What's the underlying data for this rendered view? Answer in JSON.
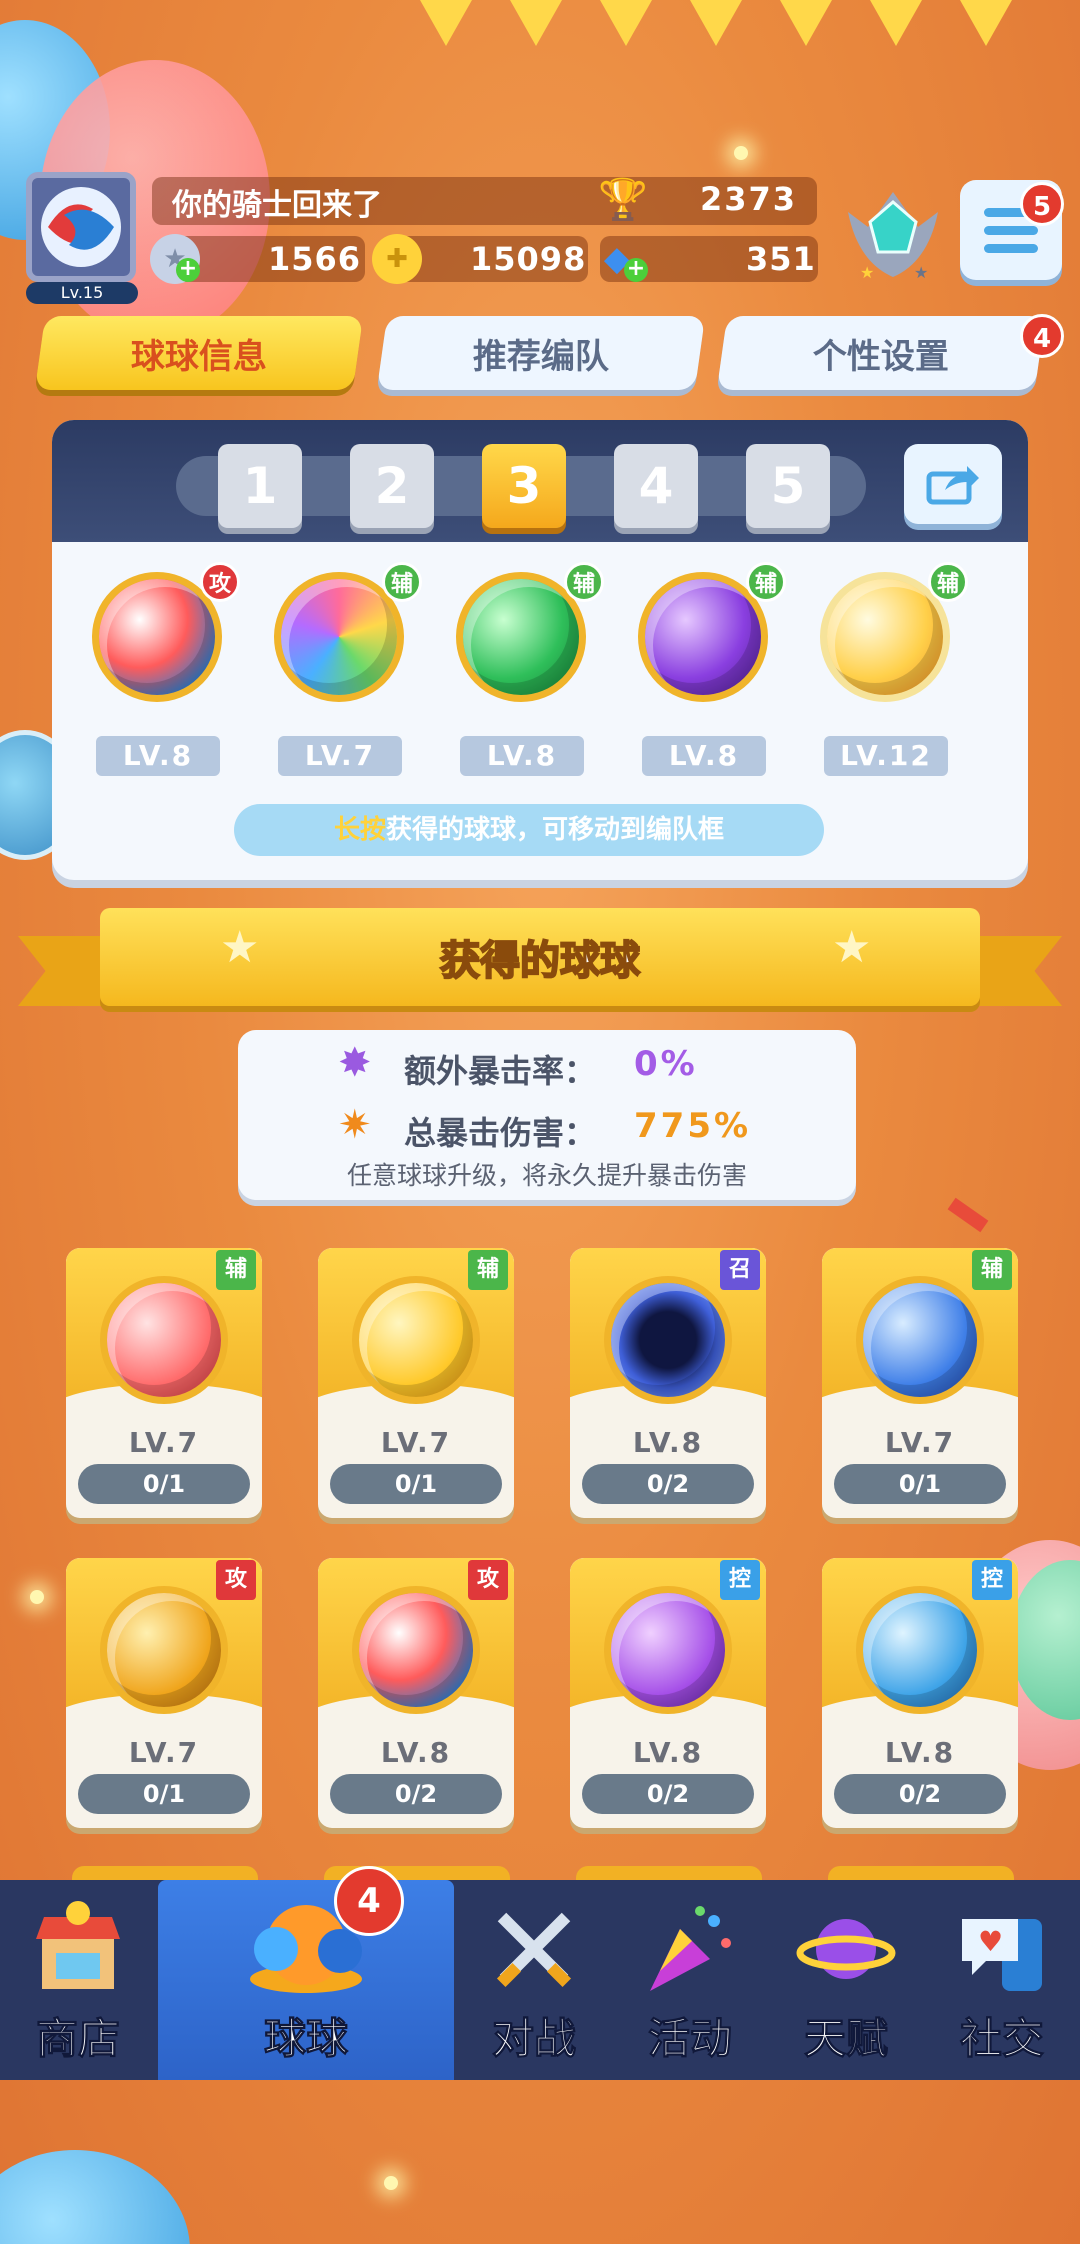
{
  "header": {
    "player_level": "Lv.15",
    "greeting": "你的骑士回来了",
    "trophies": "2373",
    "silver": "1566",
    "gold": "15098",
    "diamonds": "351",
    "menu_badge": "5"
  },
  "tabs": [
    {
      "label": "球球信息",
      "active": true
    },
    {
      "label": "推荐编队",
      "active": false
    },
    {
      "label": "个性设置",
      "active": false,
      "badge": "4"
    }
  ],
  "team": {
    "slots": [
      "1",
      "2",
      "3",
      "4",
      "5"
    ],
    "active_slot": "3",
    "balls": [
      {
        "role": "攻",
        "level": "LV.8"
      },
      {
        "role": "辅",
        "level": "LV.7"
      },
      {
        "role": "辅",
        "level": "LV.8"
      },
      {
        "role": "辅",
        "level": "LV.8"
      },
      {
        "role": "辅",
        "level": "LV.12"
      }
    ],
    "hint_highlight": "长按",
    "hint_rest": "获得的球球，可移动到编队框"
  },
  "collection": {
    "title": "获得的球球",
    "extra_crit_label": "额外暴击率：",
    "extra_crit_value": "0%",
    "total_crit_label": "总暴击伤害：",
    "total_crit_value": "775%",
    "note": "任意球球升级，将永久提升暴击伤害",
    "cards": [
      {
        "role": "辅",
        "level": "LV.7",
        "count": "0/1"
      },
      {
        "role": "辅",
        "level": "LV.7",
        "count": "0/1"
      },
      {
        "role": "召",
        "level": "LV.8",
        "count": "0/2"
      },
      {
        "role": "辅",
        "level": "LV.7",
        "count": "0/1"
      },
      {
        "role": "攻",
        "level": "LV.7",
        "count": "0/1"
      },
      {
        "role": "攻",
        "level": "LV.8",
        "count": "0/2"
      },
      {
        "role": "控",
        "level": "LV.8",
        "count": "0/2"
      },
      {
        "role": "控",
        "level": "LV.8",
        "count": "0/2"
      }
    ]
  },
  "nav": {
    "items": [
      {
        "label": "商店",
        "icon": "shop-icon"
      },
      {
        "label": "球球",
        "icon": "ball-icon",
        "active": true,
        "badge": "4"
      },
      {
        "label": "对战",
        "icon": "crossed-swords-icon"
      },
      {
        "label": "活动",
        "icon": "party-popper-icon"
      },
      {
        "label": "天赋",
        "icon": "planet-icon"
      },
      {
        "label": "社交",
        "icon": "chat-phone-icon"
      }
    ]
  },
  "colors": {
    "background": "#ea8a3f",
    "tab_active": "#f8c51e",
    "nav_bg": "#2a3761",
    "role_attack": "#e0383a",
    "role_support": "#4bb64a",
    "role_summon": "#6a55d8",
    "role_control": "#3aa0e8"
  }
}
